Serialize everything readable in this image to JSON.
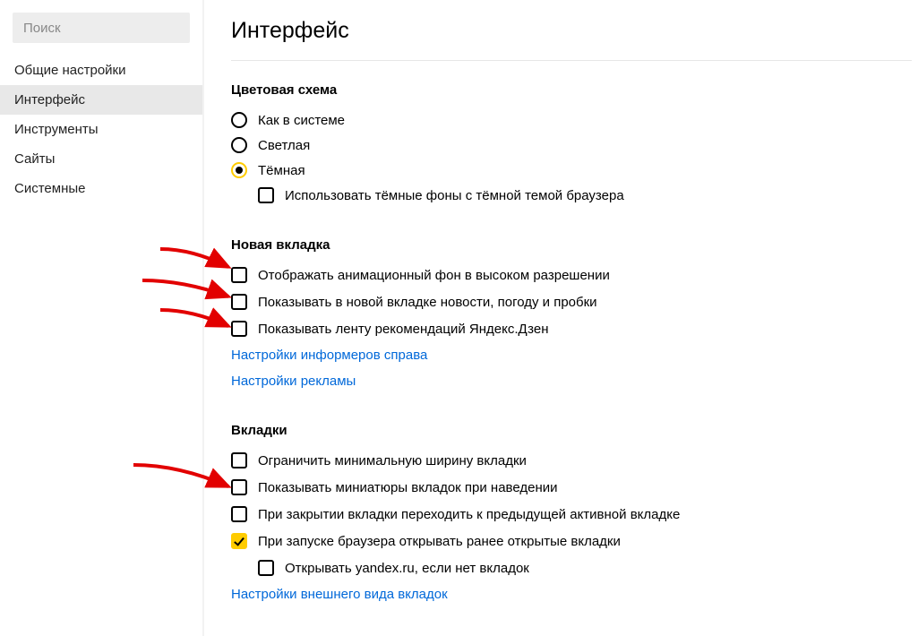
{
  "sidebar": {
    "search_placeholder": "Поиск",
    "items": [
      {
        "label": "Общие настройки",
        "active": false
      },
      {
        "label": "Интерфейс",
        "active": true
      },
      {
        "label": "Инструменты",
        "active": false
      },
      {
        "label": "Сайты",
        "active": false
      },
      {
        "label": "Системные",
        "active": false
      }
    ]
  },
  "page": {
    "title": "Интерфейс"
  },
  "color_scheme": {
    "title": "Цветовая схема",
    "options": [
      {
        "label": "Как в системе",
        "selected": false
      },
      {
        "label": "Светлая",
        "selected": false
      },
      {
        "label": "Тёмная",
        "selected": true
      }
    ],
    "dark_backgrounds": {
      "label": "Использовать тёмные фоны с тёмной темой браузера",
      "checked": false
    }
  },
  "new_tab": {
    "title": "Новая вкладка",
    "items": [
      {
        "label": "Отображать анимационный фон в высоком разрешении",
        "checked": false
      },
      {
        "label": "Показывать в новой вкладке новости, погоду и пробки",
        "checked": false
      },
      {
        "label": "Показывать ленту рекомендаций Яндекс.Дзен",
        "checked": false
      }
    ],
    "links": [
      "Настройки информеров справа",
      "Настройки рекламы"
    ]
  },
  "tabs": {
    "title": "Вкладки",
    "items": [
      {
        "label": "Ограничить минимальную ширину вкладки",
        "checked": false
      },
      {
        "label": "Показывать миниатюры вкладок при наведении",
        "checked": false
      },
      {
        "label": "При закрытии вкладки переходить к предыдущей активной вкладке",
        "checked": false
      },
      {
        "label": "При запуске браузера открывать ранее открытые вкладки",
        "checked": true
      }
    ],
    "subitem": {
      "label": "Открывать yandex.ru, если нет вкладок",
      "checked": false
    },
    "link": "Настройки внешнего вида вкладок"
  }
}
